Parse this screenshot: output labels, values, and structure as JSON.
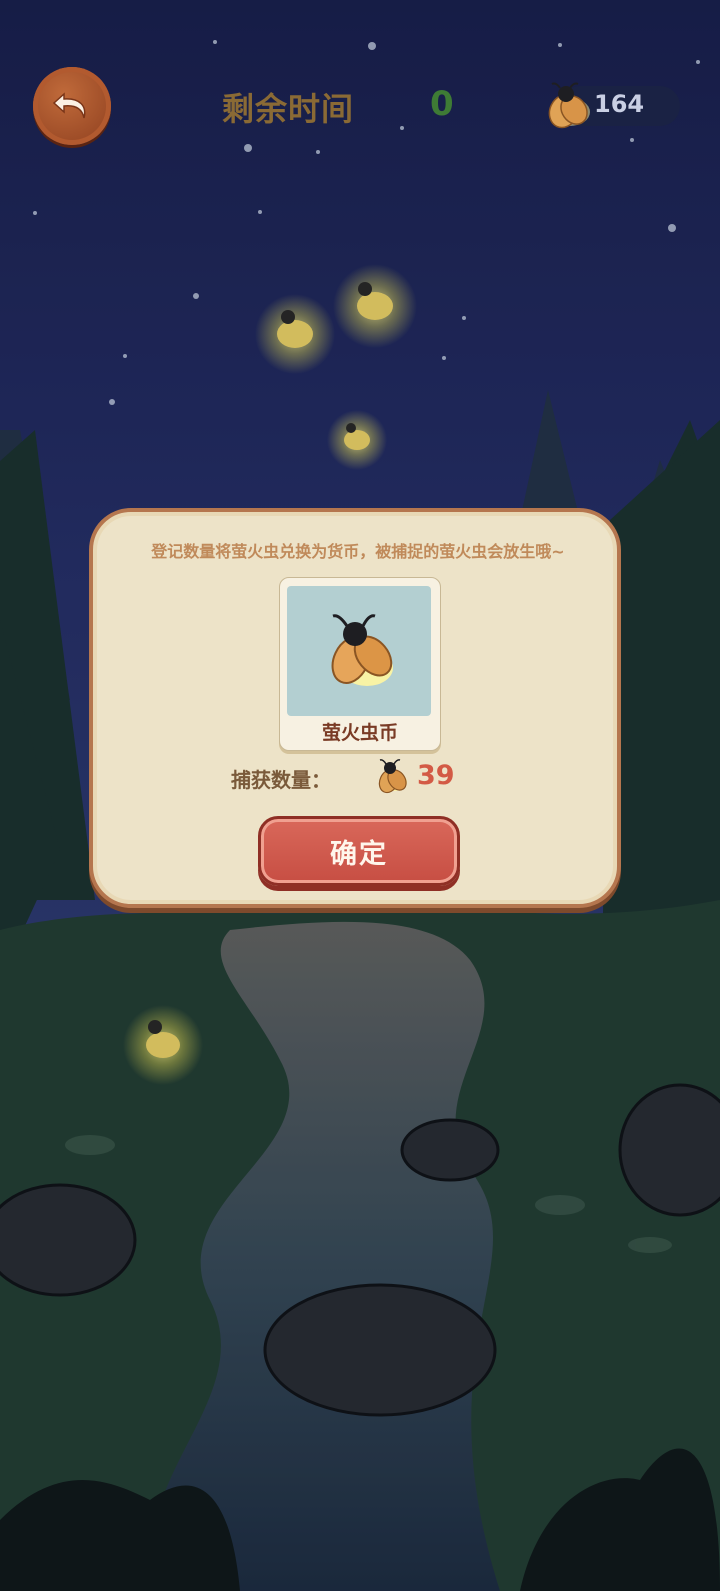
{
  "hud": {
    "back_icon": "undo-arrow-icon",
    "time_label": "剩余时间",
    "time_value": "0",
    "coin_icon": "firefly-icon",
    "coin_count": "164"
  },
  "dialog": {
    "message": "登记数量将萤火虫兑换为货币，被捕捉的萤火虫会放生哦~",
    "reward_name": "萤火虫币",
    "reward_icon": "firefly-coin-icon",
    "catch_label": "捕获数量：",
    "catch_icon": "firefly-icon",
    "catch_count": "39",
    "confirm_label": "确定"
  },
  "colors": {
    "sky": "#1b2452",
    "dialog_bg": "#ede3c8",
    "confirm_button": "#d35a4a",
    "timer": "#3e7b35",
    "count": "#d35a45"
  }
}
